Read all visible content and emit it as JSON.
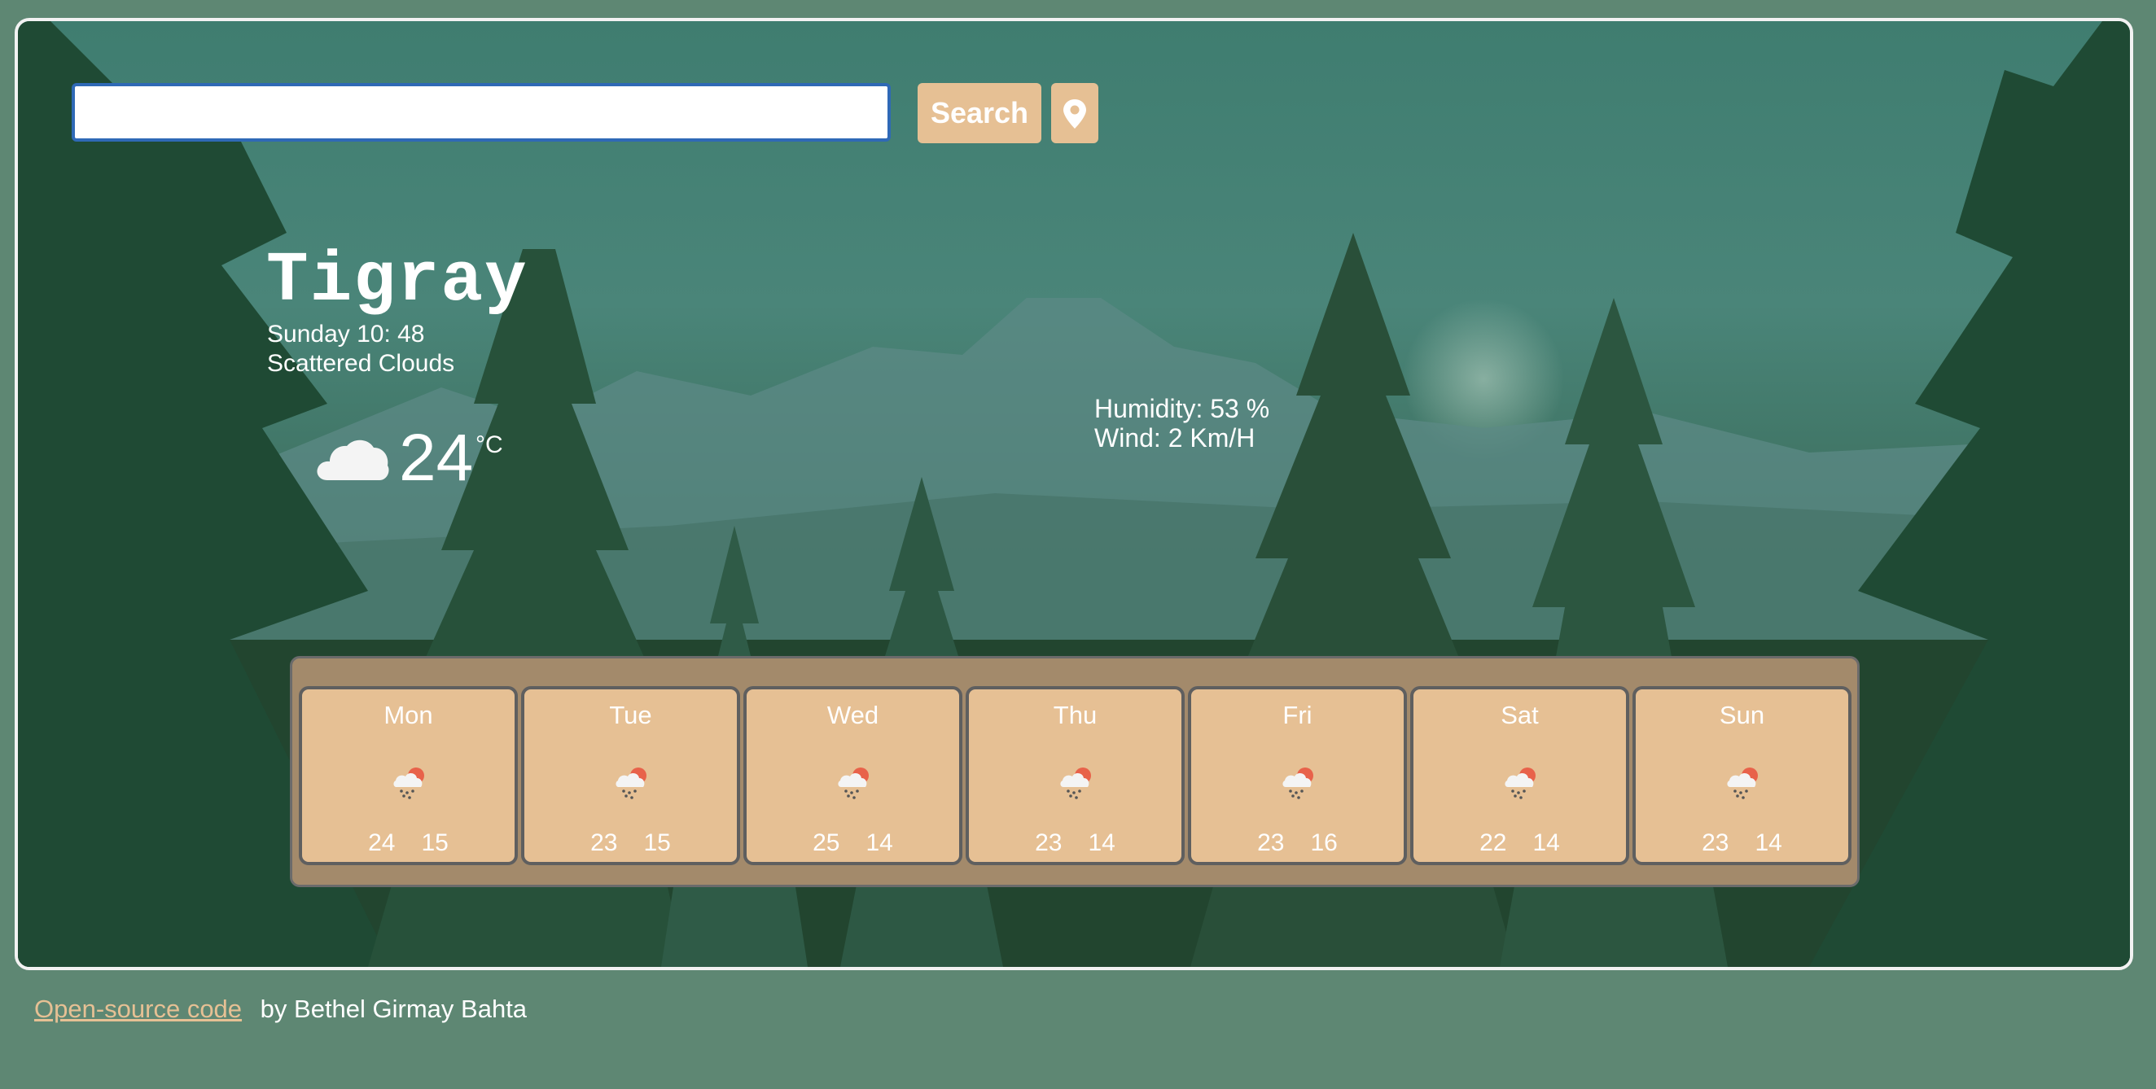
{
  "search": {
    "placeholder": "",
    "value": "",
    "button_label": "Search",
    "location_icon": "map-pin-icon"
  },
  "current": {
    "city": "Tigray",
    "datetime": "Sunday 10: 48",
    "description": "Scattered Clouds",
    "icon": "cloud-icon",
    "temperature": "24",
    "unit": "°C",
    "humidity": "Humidity: 53 %",
    "wind": "Wind: 2 Km/H"
  },
  "forecast": [
    {
      "day": "Mon",
      "max": "24",
      "min": "15",
      "icon": "rain-sun-icon"
    },
    {
      "day": "Tue",
      "max": "23",
      "min": "15",
      "icon": "rain-sun-icon"
    },
    {
      "day": "Wed",
      "max": "25",
      "min": "14",
      "icon": "rain-sun-icon"
    },
    {
      "day": "Thu",
      "max": "23",
      "min": "14",
      "icon": "rain-sun-icon"
    },
    {
      "day": "Fri",
      "max": "23",
      "min": "16",
      "icon": "rain-sun-icon"
    },
    {
      "day": "Sat",
      "max": "22",
      "min": "14",
      "icon": "rain-sun-icon"
    },
    {
      "day": "Sun",
      "max": "23",
      "min": "14",
      "icon": "rain-sun-icon"
    }
  ],
  "footer": {
    "link_text": "Open-source code",
    "byline": "by Bethel Girmay Bahta"
  },
  "colors": {
    "page_background": "#5e8773",
    "accent": "#e6c094",
    "forecast_panel": "#a38a6b",
    "input_border": "#2f69b6"
  }
}
